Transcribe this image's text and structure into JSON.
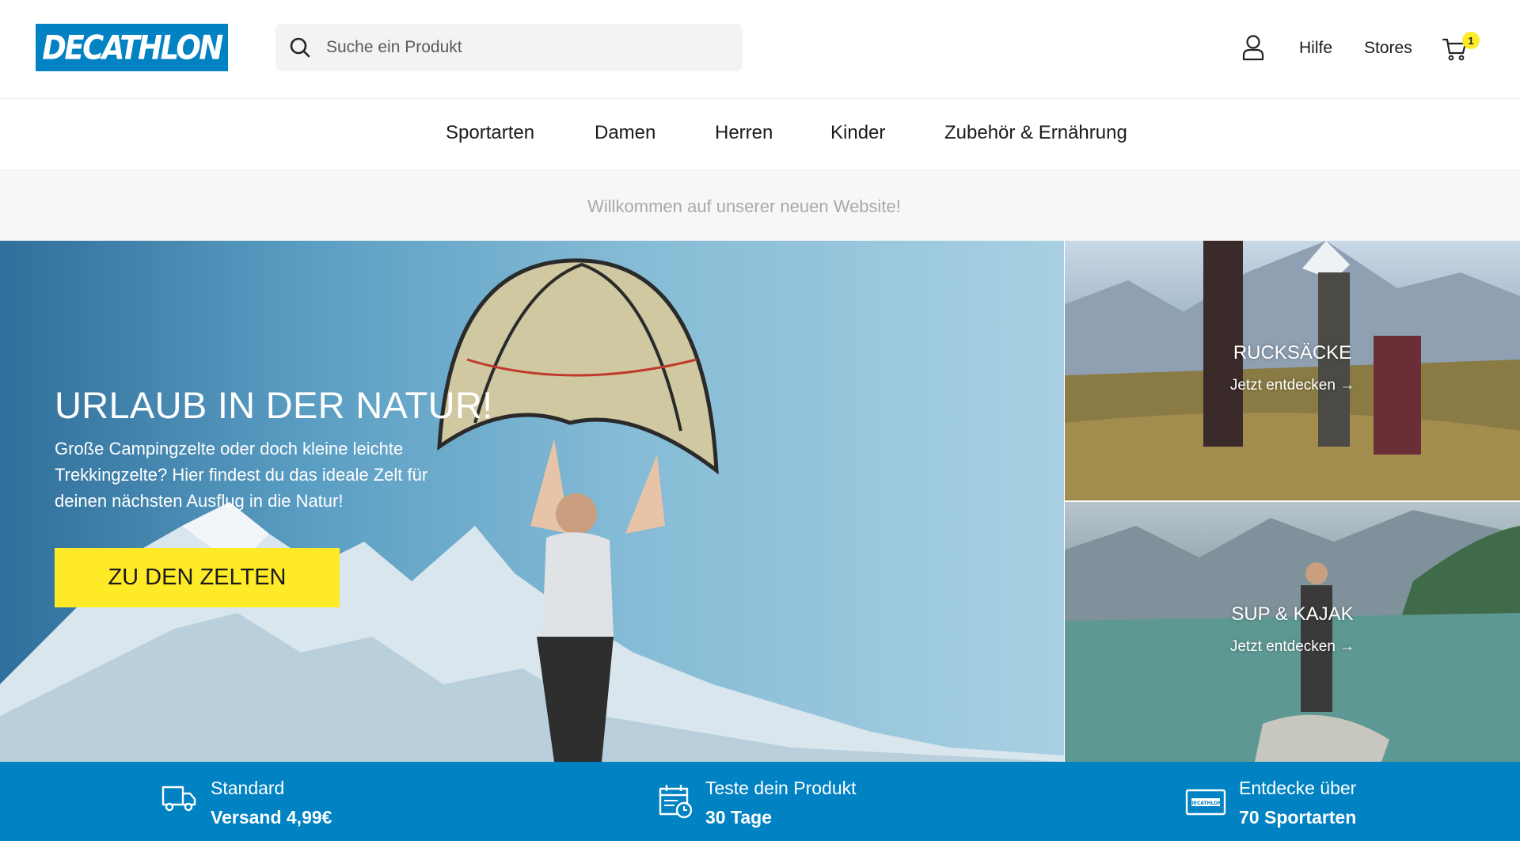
{
  "header": {
    "logo_text": "DECATHLON",
    "search_placeholder": "Suche ein Produkt",
    "help_label": "Hilfe",
    "stores_label": "Stores",
    "cart_count": "1"
  },
  "nav": {
    "items": [
      "Sportarten",
      "Damen",
      "Herren",
      "Kinder",
      "Zubehör & Ernährung"
    ]
  },
  "welcome": {
    "text": "Willkommen auf unserer neuen Website!"
  },
  "hero": {
    "title": "URLAUB IN DER NATUR!",
    "text": "Große Campingzelte oder doch kleine leichte Trekkingzelte? Hier findest du das ideale Zelt für deinen nächsten Ausflug in die Natur!",
    "button_label": "ZU DEN ZELTEN"
  },
  "tiles": [
    {
      "title": "RUCKSÄCKE",
      "link": "Jetzt entdecken →"
    },
    {
      "title": "SUP & KAJAK",
      "link": "Jetzt entdecken →"
    }
  ],
  "benefits": [
    {
      "icon": "truck-icon",
      "top": "Standard",
      "bottom": "Versand 4,99€"
    },
    {
      "icon": "calendar-clock-icon",
      "top": "Teste dein Produkt",
      "bottom": "30 Tage"
    },
    {
      "icon": "decathlon-card-icon",
      "top": "Entdecke über",
      "bottom": "70 Sportarten"
    }
  ],
  "colors": {
    "brand_blue": "#0082c3",
    "accent_yellow": "#ffea28"
  }
}
